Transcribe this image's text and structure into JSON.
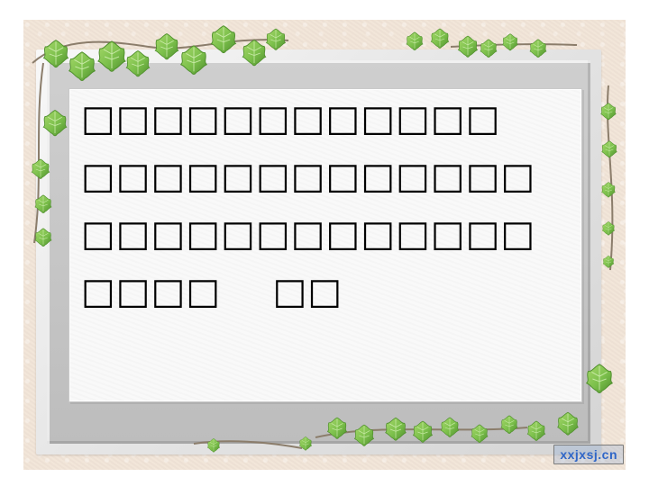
{
  "slide": {
    "lines": [
      "□□□□□□□□□□□□",
      "□□□□□□□□□□□□□",
      "□□□□□□□□□□□□□",
      "□□□□",
      "□□"
    ]
  },
  "watermark": {
    "text": "xxjxsj.cn"
  },
  "colors": {
    "backdrop": "#f1e4d7",
    "frame": "#e6e6e6",
    "paper": "#f9f9f9",
    "ivy_dark": "#4f8f2d",
    "ivy_light": "#8fca58"
  },
  "icons": [
    "ivy-vine-icon",
    "leaf-icon"
  ]
}
